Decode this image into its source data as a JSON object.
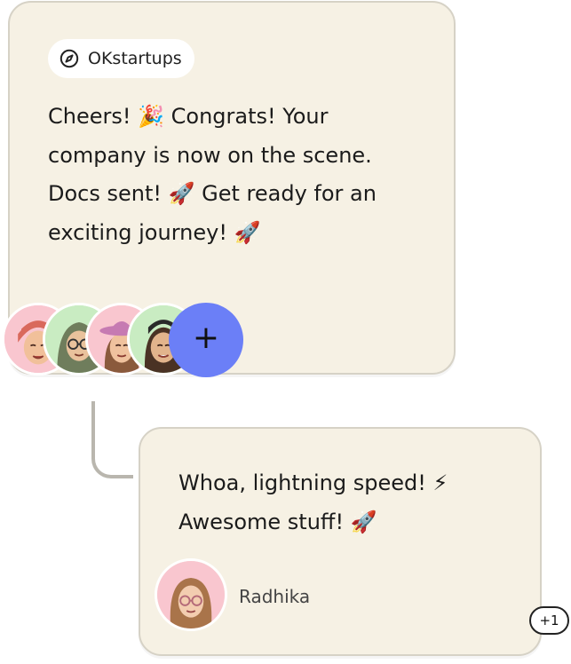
{
  "post": {
    "source_name": "OKstartups",
    "source_icon": "compass-icon",
    "lines": [
      "Cheers! 🎉 Congrats! Your",
      "company is now on the scene.",
      "Docs sent! 🚀 Get ready for an",
      "exciting journey! 🚀"
    ],
    "add_participant_label": "+",
    "colors": {
      "card_bg": "#f6f1e4",
      "accent": "#6b7ff7"
    },
    "participants": [
      {
        "icon": "memoji-avatar",
        "bg": "#f9c6cf"
      },
      {
        "icon": "memoji-avatar",
        "bg": "#c9ecc2"
      },
      {
        "icon": "memoji-avatar",
        "bg": "#f9c6cf"
      },
      {
        "icon": "memoji-avatar",
        "bg": "#c9ecc2"
      }
    ]
  },
  "reply": {
    "lines": [
      "Whoa, lightning speed! ⚡",
      "Awesome stuff! 🚀"
    ],
    "author_name": "Radhika",
    "author_icon": "memoji-avatar"
  },
  "reactions": {
    "count_label": "+1"
  }
}
